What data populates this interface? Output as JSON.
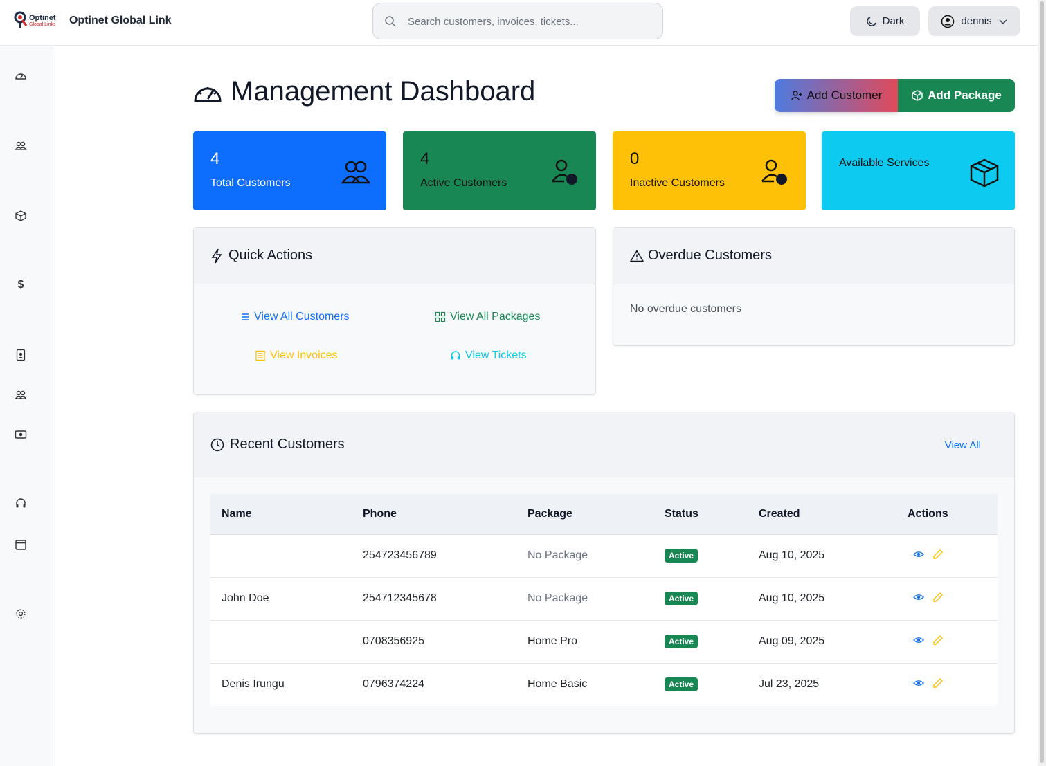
{
  "brand": {
    "logo_text_top": "Optinet",
    "logo_text_bottom": "Global Links",
    "name": "Optinet Global Link"
  },
  "search": {
    "placeholder": "Search customers, invoices, tickets..."
  },
  "header": {
    "theme_button": "Dark",
    "user_name": "dennis"
  },
  "sidebar": {
    "items": [
      {
        "icon": "speedometer-icon"
      },
      {
        "icon": "people-icon"
      },
      {
        "icon": "box-icon"
      },
      {
        "icon": "dollar-icon"
      },
      {
        "icon": "person-badge-icon"
      },
      {
        "icon": "people-icon"
      },
      {
        "icon": "cash-icon"
      },
      {
        "icon": "headset-icon"
      },
      {
        "icon": "calendar-icon"
      },
      {
        "icon": "gear-icon"
      }
    ]
  },
  "page": {
    "title": "Management Dashboard",
    "add_customer": "Add Customer",
    "add_package": "Add Package"
  },
  "stats": [
    {
      "value": "4",
      "label": "Total Customers",
      "color": "#0d6efd"
    },
    {
      "value": "4",
      "label": "Active Customers",
      "color": "#198754"
    },
    {
      "value": "0",
      "label": "Inactive Customers",
      "color": "#ffc107"
    },
    {
      "value": "",
      "label": "Available Services",
      "color": "#0dcaf0"
    }
  ],
  "quick_actions": {
    "title": "Quick Actions",
    "links": {
      "customers": "View All Customers",
      "packages": "View All Packages",
      "invoices": "View Invoices",
      "tickets": "View Tickets"
    }
  },
  "overdue": {
    "title": "Overdue Customers",
    "empty": "No overdue customers"
  },
  "recent": {
    "title": "Recent Customers",
    "view_all": "View All",
    "columns": {
      "name": "Name",
      "phone": "Phone",
      "package": "Package",
      "status": "Status",
      "created": "Created",
      "actions": "Actions"
    },
    "rows": [
      {
        "name": "",
        "phone": "254723456789",
        "package": "No Package",
        "status": "Active",
        "created": "Aug 10, 2025"
      },
      {
        "name": "John Doe",
        "phone": "254712345678",
        "package": "No Package",
        "status": "Active",
        "created": "Aug 10, 2025"
      },
      {
        "name": "",
        "phone": "0708356925",
        "package": "Home Pro",
        "status": "Active",
        "created": "Aug 09, 2025"
      },
      {
        "name": "Denis Irungu",
        "phone": "0796374224",
        "package": "Home Basic",
        "status": "Active",
        "created": "Jul 23, 2025"
      }
    ]
  }
}
